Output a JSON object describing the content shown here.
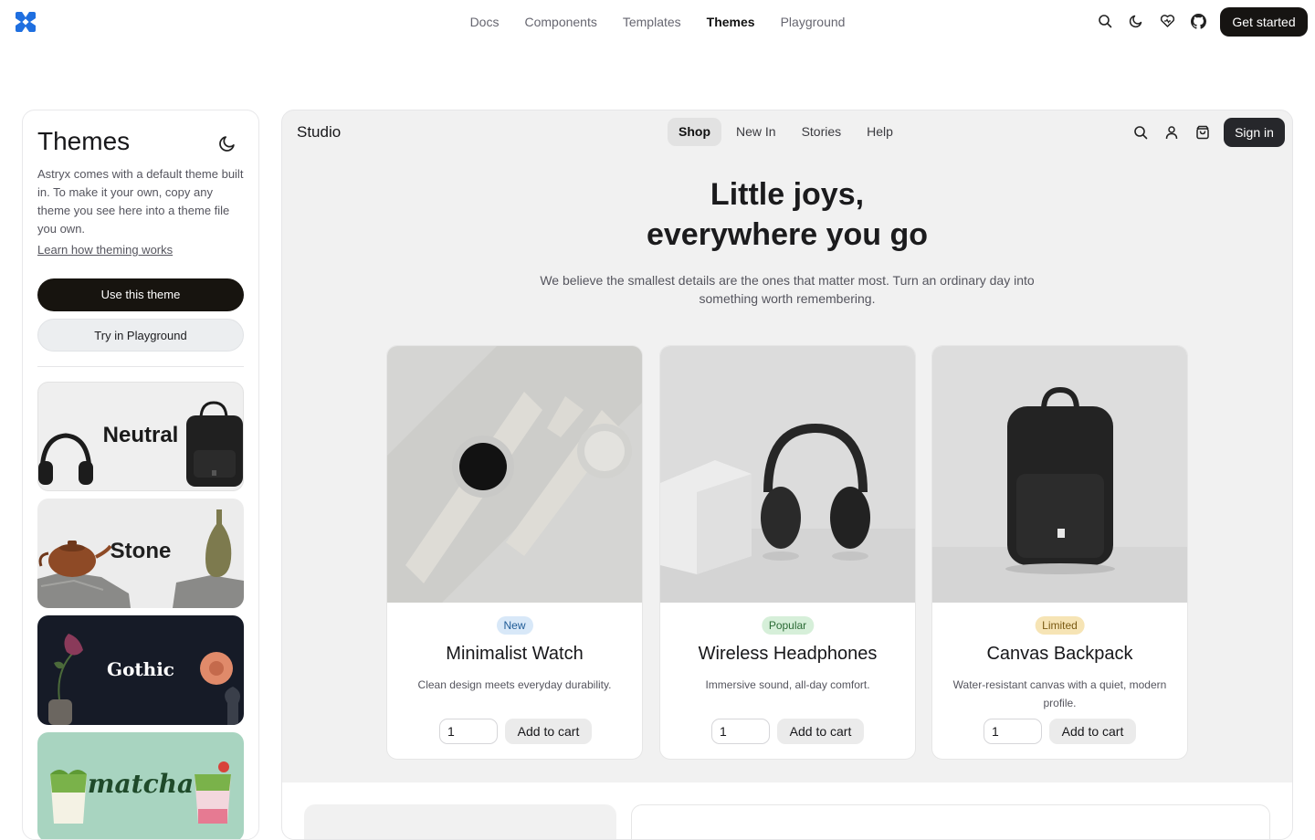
{
  "topbar": {
    "nav": [
      "Docs",
      "Components",
      "Templates",
      "Themes",
      "Playground"
    ],
    "active_nav": "Themes",
    "icons": [
      "search-icon",
      "moon-icon",
      "heart-icon",
      "github-icon"
    ],
    "cta": "Get started"
  },
  "panel": {
    "title": "Themes",
    "description": "Astryx comes with a default theme built in. To make it your own, copy any theme you see here into a theme file you own.",
    "link": "Learn how theming works",
    "primary_button": "Use this theme",
    "secondary_button": "Try in Playground",
    "themes": [
      "Neutral",
      "Stone",
      "Gothic",
      "matcha"
    ]
  },
  "preview": {
    "brand": "Studio",
    "nav": [
      "Shop",
      "New In",
      "Stories",
      "Help"
    ],
    "active_nav": "Shop",
    "sign_in": "Sign in",
    "hero_line1": "Little joys,",
    "hero_line2": "everywhere you go",
    "hero_sub": "We believe the smallest details are the ones that matter most. Turn an ordinary day into something worth remembering.",
    "products": [
      {
        "badge": "New",
        "badge_color": "#d8e8f8",
        "badge_text_color": "#1f5b96",
        "name": "Minimalist Watch",
        "desc": "Clean design meets everyday durability.",
        "qty": "1",
        "button": "Add to cart"
      },
      {
        "badge": "Popular",
        "badge_color": "#d6efd9",
        "badge_text_color": "#2b6b35",
        "name": "Wireless Headphones",
        "desc": "Immersive sound, all-day comfort.",
        "qty": "1",
        "button": "Add to cart"
      },
      {
        "badge": "Limited",
        "badge_color": "#f6e4b5",
        "badge_text_color": "#7a5a12",
        "name": "Canvas Backpack",
        "desc": "Water-resistant canvas with a quiet, modern profile.",
        "qty": "1",
        "button": "Add to cart"
      }
    ]
  }
}
